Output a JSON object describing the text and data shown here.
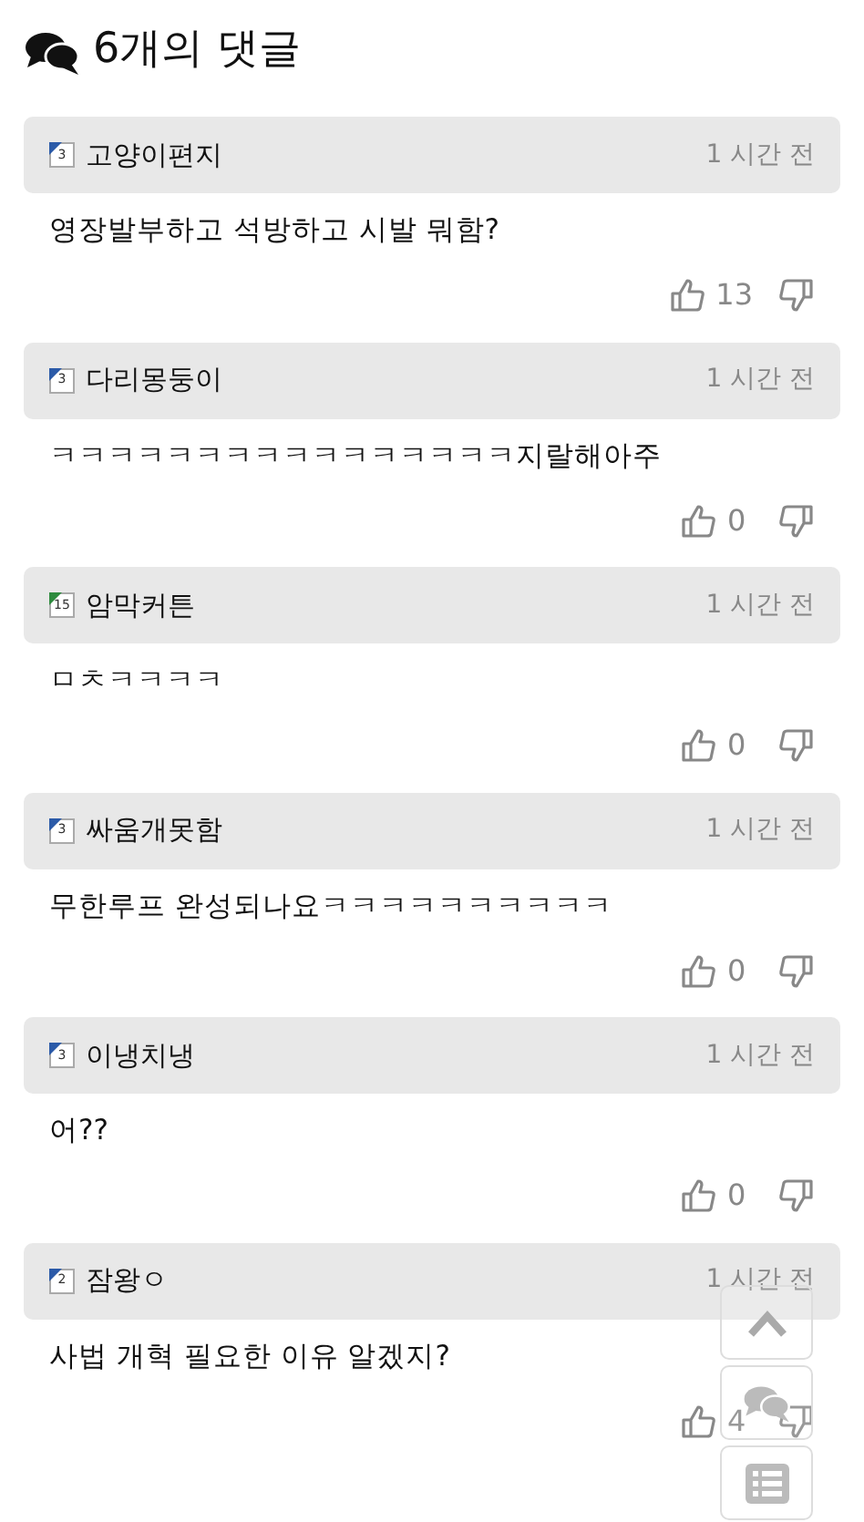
{
  "heading": "6개의 댓글",
  "comments": [
    {
      "level": "3",
      "color": "#2b5aa8",
      "author": "고양이편지",
      "time": "1 시간 전",
      "text": "영장발부하고 석방하고 시발 뭐함?",
      "likes": "13"
    },
    {
      "level": "3",
      "color": "#2b5aa8",
      "author": "다리몽둥이",
      "time": "1 시간 전",
      "text": "ㅋㅋㅋㅋㅋㅋㅋㅋㅋㅋㅋㅋㅋㅋㅋㅋ지랄해아주",
      "likes": "0"
    },
    {
      "level": "15",
      "color": "#2e8b3e",
      "author": "암막커튼",
      "time": "1 시간 전",
      "text": "ㅁㅊㅋㅋㅋㅋ",
      "likes": "0"
    },
    {
      "level": "3",
      "color": "#2b5aa8",
      "author": "싸움개못함",
      "time": "1 시간 전",
      "text": "무한루프 완성되나요ㅋㅋㅋㅋㅋㅋㅋㅋㅋㅋ",
      "likes": "0"
    },
    {
      "level": "3",
      "color": "#2b5aa8",
      "author": "이냉치냉",
      "time": "1 시간 전",
      "text": "어??",
      "likes": "0"
    },
    {
      "level": "2",
      "color": "#2b5aa8",
      "author": "잠왕ㅇ",
      "time": "1 시간 전",
      "text": "사법 개혁 필요한 이유 알겠지?",
      "likes": "4"
    }
  ]
}
